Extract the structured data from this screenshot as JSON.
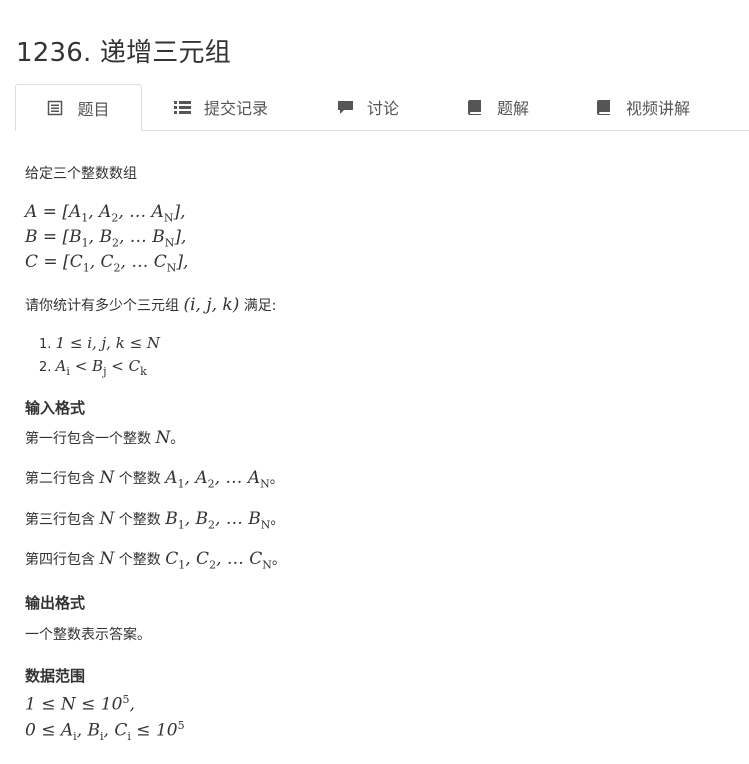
{
  "page_title": "1236. 递增三元组",
  "tabs": [
    {
      "label": "题目",
      "icon": "document-list-icon",
      "active": true
    },
    {
      "label": "提交记录",
      "icon": "list-icon",
      "active": false
    },
    {
      "label": "讨论",
      "icon": "chat-bubble-icon",
      "active": false
    },
    {
      "label": "题解",
      "icon": "book-icon",
      "active": false
    },
    {
      "label": "视频讲解",
      "icon": "book-icon",
      "active": false
    }
  ],
  "problem": {
    "intro": "给定三个整数数组",
    "arrays": {
      "a": "A = [A₁, A₂, … A_N],",
      "b": "B = [B₁, B₂, … B_N],",
      "c": "C = [C₁, C₂, … C_N],"
    },
    "question_prefix": "请你统计有多少个三元组",
    "question_math": "(i, j, k)",
    "question_suffix": "满足:",
    "conditions": [
      "1 ≤ i, j, k ≤ N",
      "A_i < B_j < C_k"
    ],
    "condition_numbers": [
      "1.",
      "2."
    ],
    "input_heading": "输入格式",
    "input_lines": [
      {
        "prefix": "第一行包含一个整数",
        "math": "N",
        "suffix": "。"
      },
      {
        "prefix": "第二行包含",
        "math": "N",
        "mid": "个整数",
        "seq": "A₁, A₂, … A_N",
        "suffix": "。"
      },
      {
        "prefix": "第三行包含",
        "math": "N",
        "mid": "个整数",
        "seq": "B₁, B₂, … B_N",
        "suffix": "。"
      },
      {
        "prefix": "第四行包含",
        "math": "N",
        "mid": "个整数",
        "seq": "C₁, C₂, … C_N",
        "suffix": "。"
      }
    ],
    "output_heading": "输出格式",
    "output_text": "一个整数表示答案。",
    "range_heading": "数据范围",
    "ranges": [
      "1 ≤ N ≤ 10⁵,",
      "0 ≤ A_i, B_i, C_i ≤ 10⁵"
    ]
  },
  "colors": {
    "text": "#333333",
    "border": "#dddddd",
    "tab_text": "#555555"
  }
}
